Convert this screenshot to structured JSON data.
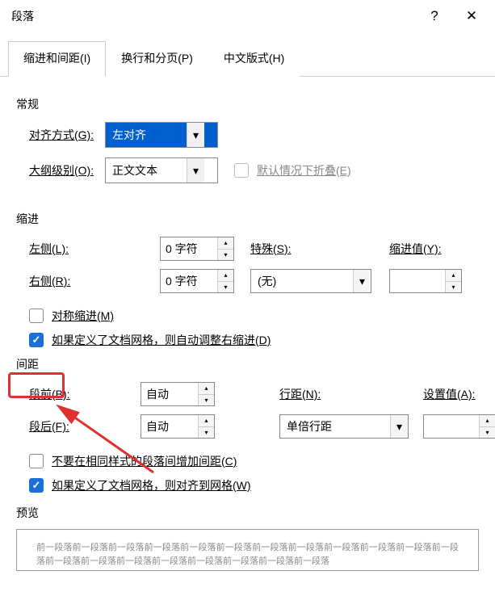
{
  "title": "段落",
  "help_icon": "?",
  "close_icon": "✕",
  "tabs": [
    {
      "label": "缩进和间距(I)",
      "active": true
    },
    {
      "label": "换行和分页(P)",
      "active": false
    },
    {
      "label": "中文版式(H)",
      "active": false
    }
  ],
  "general": {
    "section": "常规",
    "align_label": "对齐方式(G):",
    "align_value": "左对齐",
    "outline_label": "大纲级别(O):",
    "outline_value": "正文文本",
    "collapse_label": "默认情况下折叠(E)",
    "collapse_checked": false
  },
  "indent": {
    "section": "缩进",
    "left_label": "左侧(L):",
    "left_value": "0 字符",
    "right_label": "右侧(R):",
    "right_value": "0 字符",
    "special_label": "特殊(S):",
    "special_value": "(无)",
    "by_label": "缩进值(Y):",
    "by_value": "",
    "mirror_label": "对称缩进(M)",
    "mirror_checked": false,
    "grid_label": "如果定义了文档网格，则自动调整右缩进(D)",
    "grid_checked": true
  },
  "spacing": {
    "section": "间距",
    "before_label": "段前(B):",
    "before_value": "自动",
    "after_label": "段后(F):",
    "after_value": "自动",
    "line_label": "行距(N):",
    "line_value": "单倍行距",
    "at_label": "设置值(A):",
    "at_value": "",
    "nosame_label": "不要在相同样式的段落间增加间距(C)",
    "nosame_checked": false,
    "snap_label": "如果定义了文档网格，则对齐到网格(W)",
    "snap_checked": true
  },
  "preview": {
    "label": "预览",
    "text": "前一段落前一段落前一段落前一段落前一段落前一段落前一段落前一段落前一段落前一段落前一段落前一段落前一段落前一段落前一段落前一段落前一段落前一段落前一段落前一段落"
  }
}
